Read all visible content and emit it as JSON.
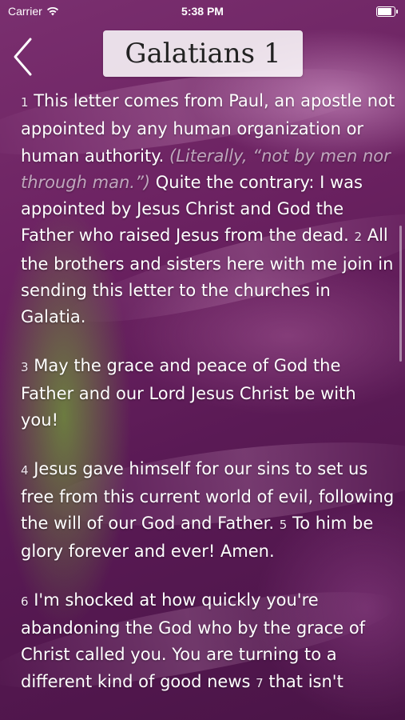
{
  "status_bar": {
    "carrier": "Carrier",
    "time": "5:38 PM"
  },
  "nav": {
    "title": "Galatians 1"
  },
  "passage": {
    "paragraphs": [
      {
        "v1_num": "1",
        "v1_text": "This letter comes from Paul, an apostle not appointed by any human organization or human authority.",
        "v1_note": "(Literally, “not by men nor through man.”)",
        "v1_cont": "Quite the contrary: I was appointed by Jesus Christ and God the Father who raised Jesus from the dead.",
        "v2_num": "2",
        "v2_text": "All the brothers and sisters here with me join in sending this letter to the churches in Galatia."
      },
      {
        "v3_num": "3",
        "v3_text": "May the grace and peace of God the Father and our Lord Jesus Christ be with you!"
      },
      {
        "v4_num": "4",
        "v4_text": "Jesus gave himself for our sins to set us free from this current world of evil, following the will of our God and Father.",
        "v5_num": "5",
        "v5_text": "To him be glory forever and ever! Amen."
      },
      {
        "v6_num": "6",
        "v6_text": "I'm shocked at how quickly you're abandoning the God who by the grace of Christ called you. You are turning to a different kind of good news",
        "v7_num": "7",
        "v7_text": "that isn't"
      }
    ]
  }
}
